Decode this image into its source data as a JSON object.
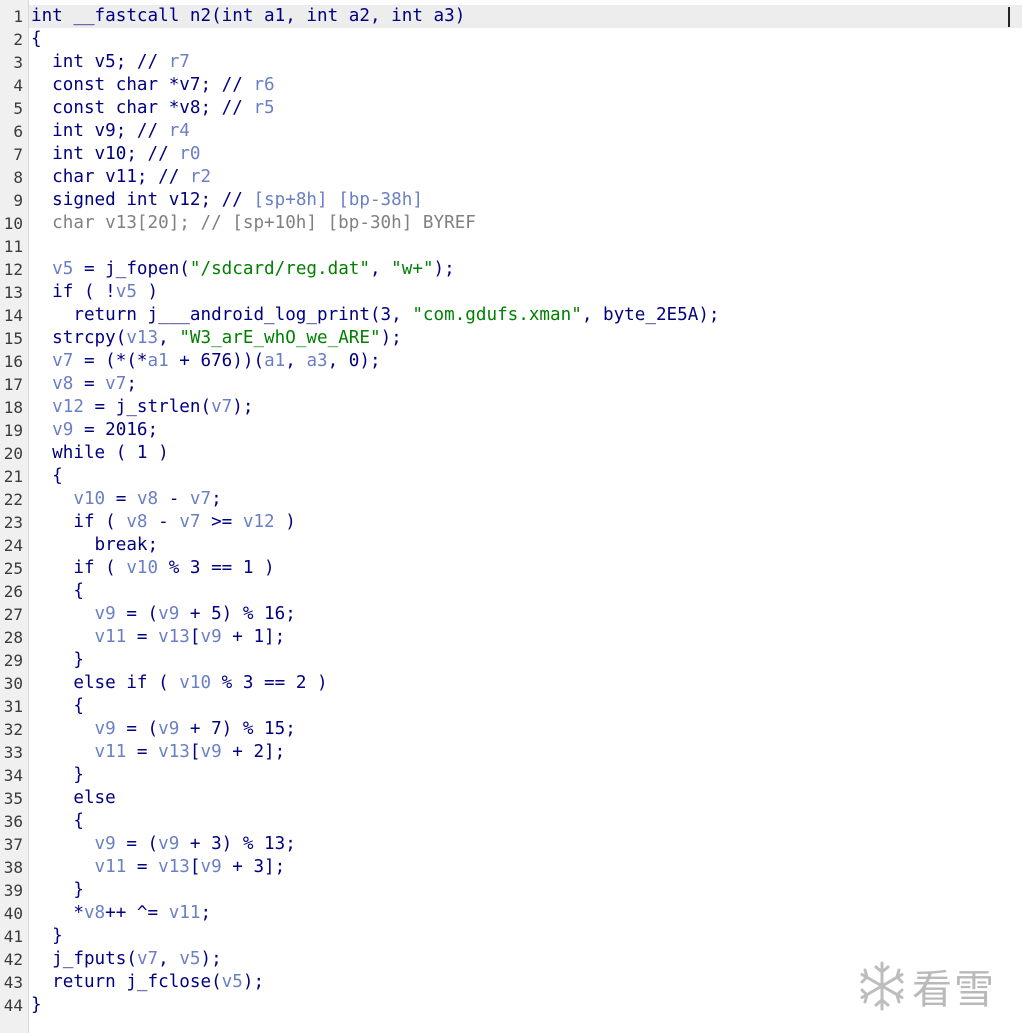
{
  "editor": {
    "lines": [
      {
        "no": "1",
        "tokens": [
          {
            "t": "int __fastcall n2(int a1, int a2, int a3)",
            "k": "pun"
          }
        ]
      },
      {
        "no": "2",
        "tokens": [
          {
            "t": "{",
            "k": "pun"
          }
        ]
      },
      {
        "no": "3",
        "tokens": [
          {
            "t": "  int v5; // ",
            "k": "pun"
          },
          {
            "t": "r7",
            "k": "cmt"
          }
        ]
      },
      {
        "no": "4",
        "tokens": [
          {
            "t": "  const char *v7; // ",
            "k": "pun"
          },
          {
            "t": "r6",
            "k": "cmt"
          }
        ]
      },
      {
        "no": "5",
        "tokens": [
          {
            "t": "  const char *v8; // ",
            "k": "pun"
          },
          {
            "t": "r5",
            "k": "cmt"
          }
        ]
      },
      {
        "no": "6",
        "tokens": [
          {
            "t": "  int v9; // ",
            "k": "pun"
          },
          {
            "t": "r4",
            "k": "cmt"
          }
        ]
      },
      {
        "no": "7",
        "tokens": [
          {
            "t": "  int v10; // ",
            "k": "pun"
          },
          {
            "t": "r0",
            "k": "cmt"
          }
        ]
      },
      {
        "no": "8",
        "tokens": [
          {
            "t": "  char v11; // ",
            "k": "pun"
          },
          {
            "t": "r2",
            "k": "cmt"
          }
        ]
      },
      {
        "no": "9",
        "tokens": [
          {
            "t": "  signed int v12; // ",
            "k": "pun"
          },
          {
            "t": "[sp+8h] [bp-38h]",
            "k": "cmt"
          }
        ]
      },
      {
        "no": "10",
        "tokens": [
          {
            "t": "  char v13[20]; // [sp+10h] [bp-30h] BYREF",
            "k": "def"
          }
        ]
      },
      {
        "no": "11",
        "tokens": []
      },
      {
        "no": "12",
        "tokens": [
          {
            "t": "  v5",
            "k": "var"
          },
          {
            "t": " = j_fopen(",
            "k": "pun"
          },
          {
            "t": "\"/sdcard/reg.dat\"",
            "k": "str"
          },
          {
            "t": ", ",
            "k": "pun"
          },
          {
            "t": "\"w+\"",
            "k": "str"
          },
          {
            "t": ");",
            "k": "pun"
          }
        ]
      },
      {
        "no": "13",
        "tokens": [
          {
            "t": "  if ( !",
            "k": "pun"
          },
          {
            "t": "v5",
            "k": "var"
          },
          {
            "t": " )",
            "k": "pun"
          }
        ]
      },
      {
        "no": "14",
        "tokens": [
          {
            "t": "    return j___android_log_print(3, ",
            "k": "pun"
          },
          {
            "t": "\"com.gdufs.xman\"",
            "k": "str"
          },
          {
            "t": ", byte_2E5A);",
            "k": "pun"
          }
        ]
      },
      {
        "no": "15",
        "tokens": [
          {
            "t": "  strcpy(",
            "k": "pun"
          },
          {
            "t": "v13",
            "k": "var"
          },
          {
            "t": ", ",
            "k": "pun"
          },
          {
            "t": "\"W3_arE_whO_we_ARE\"",
            "k": "str"
          },
          {
            "t": ");",
            "k": "pun"
          }
        ]
      },
      {
        "no": "16",
        "tokens": [
          {
            "t": "  v7",
            "k": "var"
          },
          {
            "t": " = (*(*",
            "k": "pun"
          },
          {
            "t": "a1",
            "k": "var"
          },
          {
            "t": " + 676))(",
            "k": "pun"
          },
          {
            "t": "a1",
            "k": "var"
          },
          {
            "t": ", ",
            "k": "pun"
          },
          {
            "t": "a3",
            "k": "var"
          },
          {
            "t": ", 0);",
            "k": "pun"
          }
        ]
      },
      {
        "no": "17",
        "tokens": [
          {
            "t": "  v8",
            "k": "var"
          },
          {
            "t": " = ",
            "k": "pun"
          },
          {
            "t": "v7",
            "k": "var"
          },
          {
            "t": ";",
            "k": "pun"
          }
        ]
      },
      {
        "no": "18",
        "tokens": [
          {
            "t": "  v12",
            "k": "var"
          },
          {
            "t": " = j_strlen(",
            "k": "pun"
          },
          {
            "t": "v7",
            "k": "var"
          },
          {
            "t": ");",
            "k": "pun"
          }
        ]
      },
      {
        "no": "19",
        "tokens": [
          {
            "t": "  v9",
            "k": "var"
          },
          {
            "t": " = 2016;",
            "k": "pun"
          }
        ]
      },
      {
        "no": "20",
        "tokens": [
          {
            "t": "  while ( 1 )",
            "k": "pun"
          }
        ]
      },
      {
        "no": "21",
        "tokens": [
          {
            "t": "  {",
            "k": "pun"
          }
        ]
      },
      {
        "no": "22",
        "tokens": [
          {
            "t": "    v10",
            "k": "var"
          },
          {
            "t": " = ",
            "k": "pun"
          },
          {
            "t": "v8",
            "k": "var"
          },
          {
            "t": " - ",
            "k": "pun"
          },
          {
            "t": "v7",
            "k": "var"
          },
          {
            "t": ";",
            "k": "pun"
          }
        ]
      },
      {
        "no": "23",
        "tokens": [
          {
            "t": "    if ( ",
            "k": "pun"
          },
          {
            "t": "v8",
            "k": "var"
          },
          {
            "t": " - ",
            "k": "pun"
          },
          {
            "t": "v7",
            "k": "var"
          },
          {
            "t": " >= ",
            "k": "pun"
          },
          {
            "t": "v12",
            "k": "var"
          },
          {
            "t": " )",
            "k": "pun"
          }
        ]
      },
      {
        "no": "24",
        "tokens": [
          {
            "t": "      break;",
            "k": "pun"
          }
        ]
      },
      {
        "no": "25",
        "tokens": [
          {
            "t": "    if ( ",
            "k": "pun"
          },
          {
            "t": "v10",
            "k": "var"
          },
          {
            "t": " % 3 == 1 )",
            "k": "pun"
          }
        ]
      },
      {
        "no": "26",
        "tokens": [
          {
            "t": "    {",
            "k": "pun"
          }
        ]
      },
      {
        "no": "27",
        "tokens": [
          {
            "t": "      v9",
            "k": "var"
          },
          {
            "t": " = (",
            "k": "pun"
          },
          {
            "t": "v9",
            "k": "var"
          },
          {
            "t": " + 5) % 16;",
            "k": "pun"
          }
        ]
      },
      {
        "no": "28",
        "tokens": [
          {
            "t": "      v11",
            "k": "var"
          },
          {
            "t": " = ",
            "k": "pun"
          },
          {
            "t": "v13",
            "k": "var"
          },
          {
            "t": "[",
            "k": "pun"
          },
          {
            "t": "v9",
            "k": "var"
          },
          {
            "t": " + 1];",
            "k": "pun"
          }
        ]
      },
      {
        "no": "29",
        "tokens": [
          {
            "t": "    }",
            "k": "pun"
          }
        ]
      },
      {
        "no": "30",
        "tokens": [
          {
            "t": "    else if ( ",
            "k": "pun"
          },
          {
            "t": "v10",
            "k": "var"
          },
          {
            "t": " % 3 == 2 )",
            "k": "pun"
          }
        ]
      },
      {
        "no": "31",
        "tokens": [
          {
            "t": "    {",
            "k": "pun"
          }
        ]
      },
      {
        "no": "32",
        "tokens": [
          {
            "t": "      v9",
            "k": "var"
          },
          {
            "t": " = (",
            "k": "pun"
          },
          {
            "t": "v9",
            "k": "var"
          },
          {
            "t": " + 7) % 15;",
            "k": "pun"
          }
        ]
      },
      {
        "no": "33",
        "tokens": [
          {
            "t": "      v11",
            "k": "var"
          },
          {
            "t": " = ",
            "k": "pun"
          },
          {
            "t": "v13",
            "k": "var"
          },
          {
            "t": "[",
            "k": "pun"
          },
          {
            "t": "v9",
            "k": "var"
          },
          {
            "t": " + 2];",
            "k": "pun"
          }
        ]
      },
      {
        "no": "34",
        "tokens": [
          {
            "t": "    }",
            "k": "pun"
          }
        ]
      },
      {
        "no": "35",
        "tokens": [
          {
            "t": "    else",
            "k": "pun"
          }
        ]
      },
      {
        "no": "36",
        "tokens": [
          {
            "t": "    {",
            "k": "pun"
          }
        ]
      },
      {
        "no": "37",
        "tokens": [
          {
            "t": "      v9",
            "k": "var"
          },
          {
            "t": " = (",
            "k": "pun"
          },
          {
            "t": "v9",
            "k": "var"
          },
          {
            "t": " + 3) % 13;",
            "k": "pun"
          }
        ]
      },
      {
        "no": "38",
        "tokens": [
          {
            "t": "      v11",
            "k": "var"
          },
          {
            "t": " = ",
            "k": "pun"
          },
          {
            "t": "v13",
            "k": "var"
          },
          {
            "t": "[",
            "k": "pun"
          },
          {
            "t": "v9",
            "k": "var"
          },
          {
            "t": " + 3];",
            "k": "pun"
          }
        ]
      },
      {
        "no": "39",
        "tokens": [
          {
            "t": "    }",
            "k": "pun"
          }
        ]
      },
      {
        "no": "40",
        "tokens": [
          {
            "t": "    *",
            "k": "pun"
          },
          {
            "t": "v8",
            "k": "var"
          },
          {
            "t": "++ ^= ",
            "k": "pun"
          },
          {
            "t": "v11",
            "k": "var"
          },
          {
            "t": ";",
            "k": "pun"
          }
        ]
      },
      {
        "no": "41",
        "tokens": [
          {
            "t": "  }",
            "k": "pun"
          }
        ]
      },
      {
        "no": "42",
        "tokens": [
          {
            "t": "  j_fputs(",
            "k": "pun"
          },
          {
            "t": "v7",
            "k": "var"
          },
          {
            "t": ", ",
            "k": "pun"
          },
          {
            "t": "v5",
            "k": "var"
          },
          {
            "t": ");",
            "k": "pun"
          }
        ]
      },
      {
        "no": "43",
        "tokens": [
          {
            "t": "  return j_fclose(",
            "k": "pun"
          },
          {
            "t": "v5",
            "k": "var"
          },
          {
            "t": ");",
            "k": "pun"
          }
        ]
      },
      {
        "no": "44",
        "tokens": [
          {
            "t": "}",
            "k": "pun"
          }
        ]
      }
    ]
  },
  "watermark": {
    "icon": "snowflake-icon",
    "text": "看雪"
  }
}
